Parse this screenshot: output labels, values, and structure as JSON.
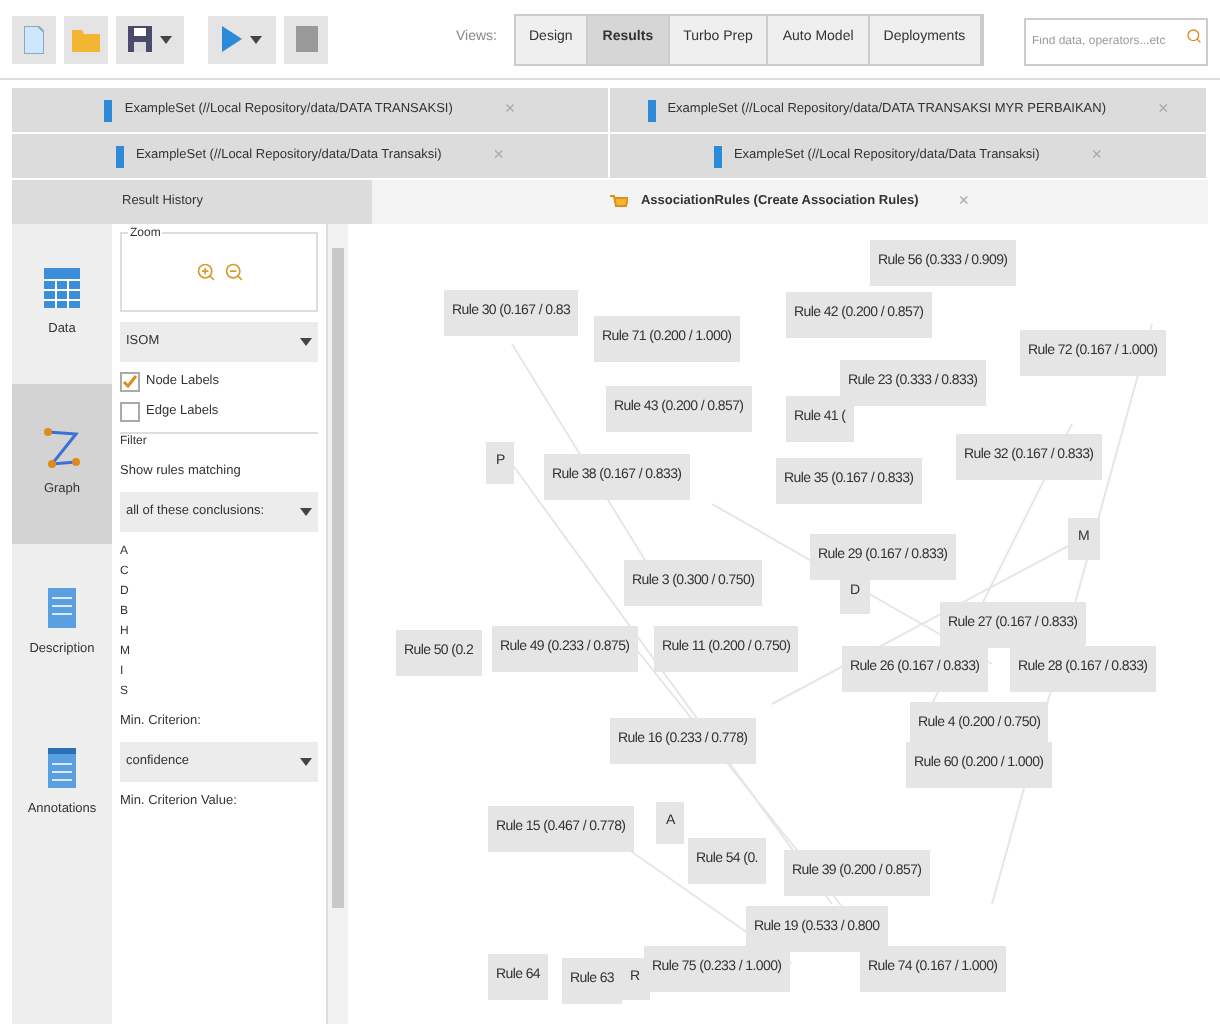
{
  "toolbar": {
    "views_label": "Views:",
    "views": [
      {
        "label": "Design",
        "selected": false
      },
      {
        "label": "Results",
        "selected": true
      },
      {
        "label": "Turbo Prep",
        "selected": false
      },
      {
        "label": "Auto Model",
        "selected": false
      },
      {
        "label": "Deployments",
        "selected": false
      }
    ],
    "search": {
      "placeholder": "Find data, operators...etc"
    }
  },
  "tab_rows": [
    [
      {
        "label": "ExampleSet (//Local Repository/data/DATA TRANSAKSI)",
        "close": "×",
        "selected": false
      },
      {
        "label": "ExampleSet (//Local Repository/data/DATA TRANSAKSI MYR PERBAIKAN)",
        "close": "×",
        "selected": false
      }
    ],
    [
      {
        "label": "ExampleSet (//Local Repository/data/Data Transaksi)",
        "close": "×",
        "selected": false
      },
      {
        "label": "ExampleSet (//Local Repository/data/Data Transaksi)",
        "close": "×",
        "selected": false
      }
    ]
  ],
  "result_tabs": [
    {
      "label": "Result History",
      "selected": false
    },
    {
      "label": "AssociationRules (Create Association Rules)",
      "close": "×",
      "selected": true
    }
  ],
  "side_nav": [
    {
      "label": "Data",
      "kind": "data",
      "selected": false
    },
    {
      "label": "Graph",
      "kind": "graph",
      "selected": true
    },
    {
      "label": "Description",
      "kind": "description",
      "selected": false
    },
    {
      "label": "Annotations",
      "kind": "annotations",
      "selected": false
    }
  ],
  "panel": {
    "zoom_label": "Zoom",
    "layout": "ISOM",
    "node_labels": {
      "label": "Node Labels",
      "checked": true
    },
    "edge_labels": {
      "label": "Edge Labels",
      "checked": false
    },
    "filter_label": "Filter",
    "show_rules": "Show rules matching",
    "match": "all of these conclusions:",
    "conclusions": [
      "A",
      "C",
      "D",
      "B",
      "H",
      "M",
      "I",
      "S"
    ],
    "min_criterion_label": "Min. Criterion:",
    "min_criterion": "confidence",
    "min_value_label": "Min. Criterion Value:"
  },
  "graph_nodes": [
    {
      "label": "Rule 56 (0.333 / 0.909)",
      "kind": "rule"
    },
    {
      "label": "Rule 30 (0.167 / 0.83",
      "kind": "rule"
    },
    {
      "label": "Rule 71 (0.200 / 1.000)",
      "kind": "rule"
    },
    {
      "label": "Rule 42 (0.200 / 0.857)",
      "kind": "rule"
    },
    {
      "label": "Rule 72 (0.167 / 1.000)",
      "kind": "rule"
    },
    {
      "label": "Rule 23 (0.333 / 0.833)",
      "kind": "rule"
    },
    {
      "label": "Rule 43 (0.200 / 0.857)",
      "kind": "rule"
    },
    {
      "label": "Rule 41 (",
      "kind": "rule"
    },
    {
      "label": "P",
      "kind": "item"
    },
    {
      "label": "Rule 38 (0.167 / 0.833)",
      "kind": "rule"
    },
    {
      "label": "Rule 35 (0.167 / 0.833)",
      "kind": "rule"
    },
    {
      "label": "Rule 32 (0.167 / 0.833)",
      "kind": "rule"
    },
    {
      "label": "M",
      "kind": "item"
    },
    {
      "label": "Rule 29 (0.167 / 0.833)",
      "kind": "rule"
    },
    {
      "label": "Rule 3 (0.300 / 0.750)",
      "kind": "rule"
    },
    {
      "label": "D",
      "kind": "item"
    },
    {
      "label": "Rule 27 (0.167 / 0.833)",
      "kind": "rule"
    },
    {
      "label": "Rule 50 (0.2",
      "kind": "rule"
    },
    {
      "label": "Rule 49 (0.233 / 0.875)",
      "kind": "rule"
    },
    {
      "label": "Rule 11 (0.200 / 0.750)",
      "kind": "rule"
    },
    {
      "label": "Rule 26 (0.167 / 0.833)",
      "kind": "rule"
    },
    {
      "label": "Rule 28 (0.167 / 0.833)",
      "kind": "rule"
    },
    {
      "label": "Rule 4 (0.200 / 0.750)",
      "kind": "rule"
    },
    {
      "label": "Rule 16 (0.233 / 0.778)",
      "kind": "rule"
    },
    {
      "label": "Rule 60 (0.200 / 1.000)",
      "kind": "rule"
    },
    {
      "label": "Rule 15 (0.467 / 0.778)",
      "kind": "rule"
    },
    {
      "label": "A",
      "kind": "item"
    },
    {
      "label": "Rule 54 (0.",
      "kind": "rule"
    },
    {
      "label": "Rule 39 (0.200 / 0.857)",
      "kind": "rule"
    },
    {
      "label": "Rule 19 (0.533 / 0.800",
      "kind": "rule"
    },
    {
      "label": "Rule 64",
      "kind": "rule"
    },
    {
      "label": "Rule 63",
      "kind": "rule"
    },
    {
      "label": "R",
      "kind": "item"
    },
    {
      "label": "Rule 75 (0.233 / 1.000)",
      "kind": "rule"
    },
    {
      "label": "Rule 74 (0.167 / 1.000)",
      "kind": "rule"
    }
  ]
}
